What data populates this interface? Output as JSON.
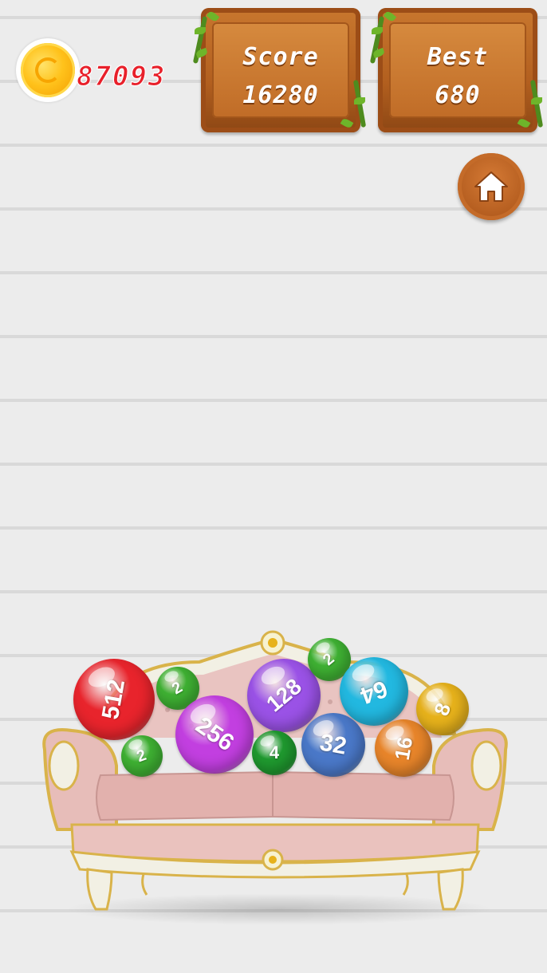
{
  "coins": {
    "value": "87093",
    "icon": "candy-coin-icon"
  },
  "score": {
    "label": "Score",
    "value": "16280"
  },
  "best": {
    "label": "Best",
    "value": "680"
  },
  "home_button": {
    "icon": "home-icon"
  },
  "balls": [
    {
      "value": "512",
      "color": "#e8242c",
      "rotation": -80
    },
    {
      "value": "2",
      "color": "#3fb233",
      "rotation": -30
    },
    {
      "value": "2",
      "color": "#3fb233",
      "rotation": -20
    },
    {
      "value": "256",
      "color": "#c23fe0",
      "rotation": 35
    },
    {
      "value": "128",
      "color": "#9a52e6",
      "rotation": -40
    },
    {
      "value": "2",
      "color": "#3fb233",
      "rotation": -40
    },
    {
      "value": "4",
      "color": "#1f9a2f",
      "rotation": 0
    },
    {
      "value": "64",
      "color": "#22b8e0",
      "rotation": 160
    },
    {
      "value": "32",
      "color": "#4a78c8",
      "rotation": 10
    },
    {
      "value": "16",
      "color": "#e8852a",
      "rotation": -80
    },
    {
      "value": "8",
      "color": "#e7b21b",
      "rotation": -70
    }
  ]
}
